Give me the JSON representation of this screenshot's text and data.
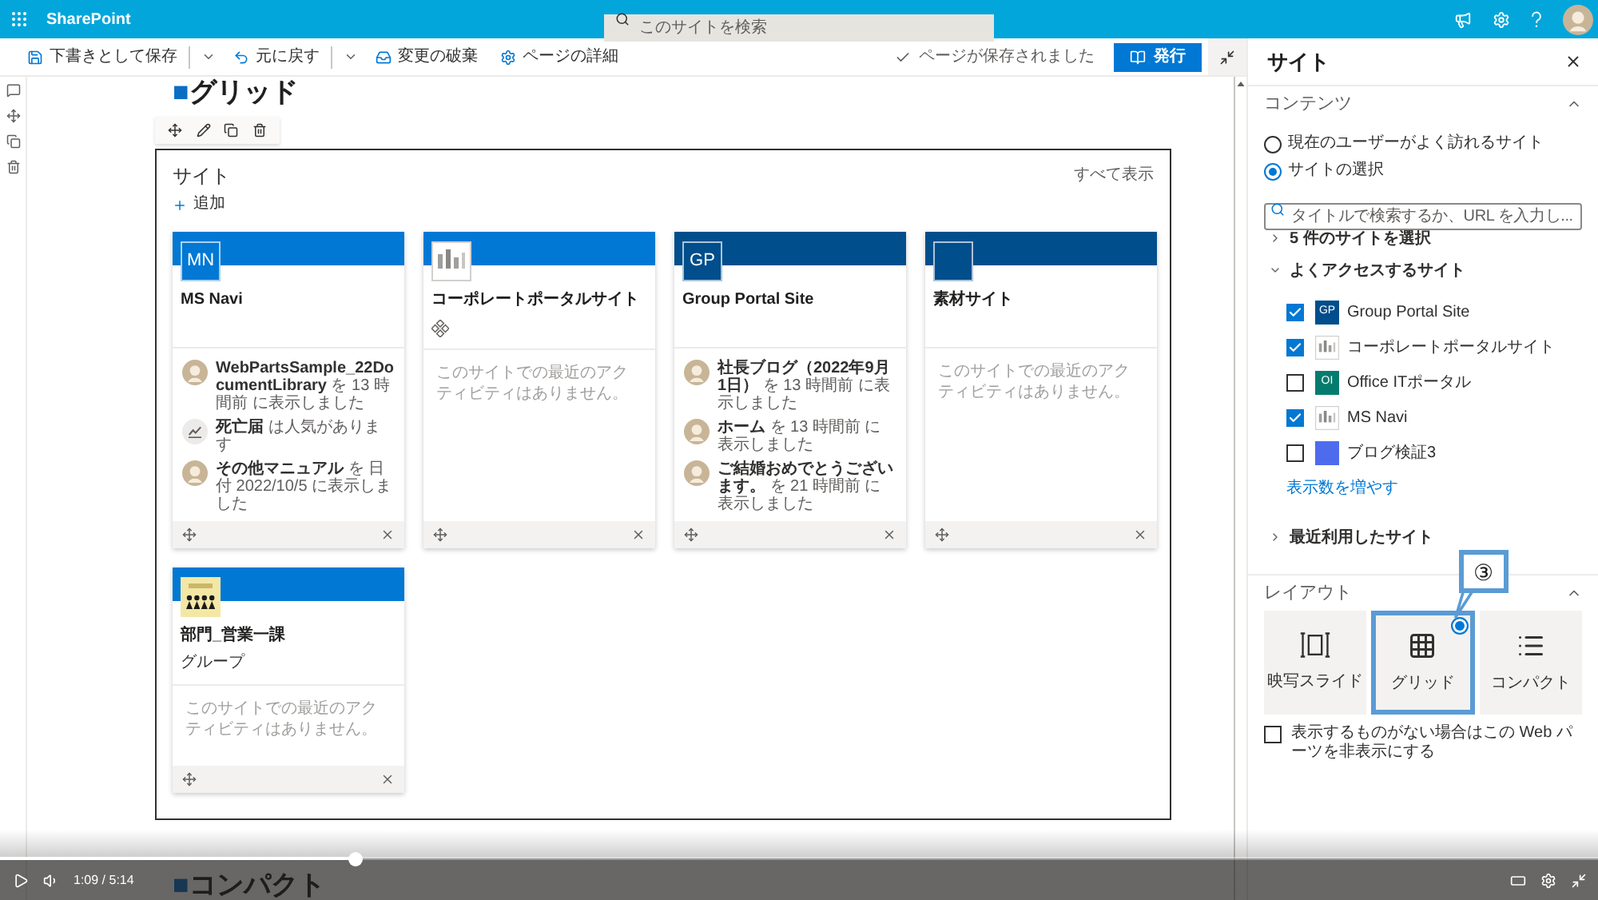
{
  "top_bar": {
    "app_name": "SharePoint",
    "search": {
      "placeholder": "このサイトを検索"
    }
  },
  "command_bar": {
    "actions": [
      {
        "label": "下書きとして保存",
        "dropdown": true
      },
      {
        "label": "元に戻す",
        "dropdown": true
      },
      {
        "label": "変更の破棄",
        "dropdown": false
      },
      {
        "label": "ページの詳細",
        "dropdown": false
      }
    ],
    "status": "ページが保存されました",
    "publish": "発行"
  },
  "sections": [
    {
      "marker": "■",
      "heading": "グリッド",
      "web_part": {
        "title": "サイト",
        "see_all": "すべて表示",
        "add": "追加",
        "cards": [
          {
            "color": "#0078d4",
            "logo": {
              "kind": "initials",
              "text": "MN"
            },
            "title": "MS Navi",
            "hub": false,
            "activities": [
              {
                "kind": "person",
                "text": "**WebPartsSample_22DocumentLibrary** を 13 時間前 に表示しました"
              },
              {
                "kind": "trending",
                "text": "**死亡届** は人気があります"
              },
              {
                "kind": "person",
                "text": "**その他マニュアル** を 日付 2022/10/5 に表示しました"
              }
            ]
          },
          {
            "color": "#0078d4",
            "logo": {
              "kind": "image"
            },
            "title": "コーポレートポータルサイト",
            "hub": true,
            "empty_message": "このサイトでの最近のアクティビティはありません。"
          },
          {
            "color": "#004e8c",
            "logo": {
              "kind": "initials",
              "text": "GP"
            },
            "title": "Group Portal Site",
            "hub": false,
            "activities": [
              {
                "kind": "person",
                "text": "**社長ブログ（2022年9月1日）** を 13 時間前 に表示しました"
              },
              {
                "kind": "person",
                "text": "**ホーム** を 13 時間前 に表示しました"
              },
              {
                "kind": "person",
                "text": "**ご結婚おめでとうございます。** を 21 時間前 に表示しました"
              }
            ]
          },
          {
            "color": "#004e8c",
            "logo": {
              "kind": "blank"
            },
            "title": "素材サイト",
            "hub": false,
            "empty_message": "このサイトでの最近のアクティビティはありません。"
          },
          {
            "color": "#0078d4",
            "logo": {
              "kind": "team"
            },
            "title": "部門_営業一課",
            "subtitle": "グループ",
            "hub": false,
            "empty_message": "このサイトでの最近のアクティビティはありません。"
          }
        ]
      }
    },
    {
      "marker": "■",
      "heading": "コンパクト"
    }
  ],
  "property_pane": {
    "title": "サイト",
    "content": {
      "heading": "コンテンツ",
      "expanded": true,
      "source_options": [
        {
          "label": "現在のユーザーがよく訪れるサイト",
          "selected": false
        },
        {
          "label": "サイトの選択",
          "selected": true
        }
      ],
      "search": {
        "placeholder": "タイトルで検索するか、URL を入力し..."
      },
      "groups": [
        {
          "label": "5 件のサイトを選択",
          "expanded": false
        },
        {
          "label": "よくアクセスするサイト",
          "expanded": true,
          "sites": [
            {
              "label": "Group Portal Site",
              "checked": true,
              "logo": {
                "kind": "initials",
                "text": "GP",
                "color": "#004e8c"
              }
            },
            {
              "label": "コーポレートポータルサイト",
              "checked": true,
              "logo": {
                "kind": "image"
              }
            },
            {
              "label": "Office ITポータル",
              "checked": false,
              "logo": {
                "kind": "initials",
                "text": "OI",
                "color": "#037c6e"
              }
            },
            {
              "label": "MS Navi",
              "checked": true,
              "logo": {
                "kind": "image"
              }
            },
            {
              "label": "ブログ検証3",
              "checked": false,
              "logo": {
                "kind": "blank",
                "color": "#4f6bed"
              }
            }
          ],
          "more_link": "表示数を増やす"
        },
        {
          "label": "最近利用したサイト",
          "expanded": false
        }
      ]
    },
    "layout": {
      "heading": "レイアウト",
      "expanded": true,
      "options": [
        {
          "label": "映写スライド",
          "selected": false
        },
        {
          "label": "グリッド",
          "selected": true
        },
        {
          "label": "コンパクト",
          "selected": false
        }
      ],
      "hide_if_empty": {
        "label": "表示するものがない場合はこの Web パーツを非表示にする",
        "checked": false
      }
    },
    "annotation": {
      "callout": "③"
    }
  },
  "video_player": {
    "time": "1:09 / 5:14",
    "progress": {
      "level": 0.222
    }
  }
}
